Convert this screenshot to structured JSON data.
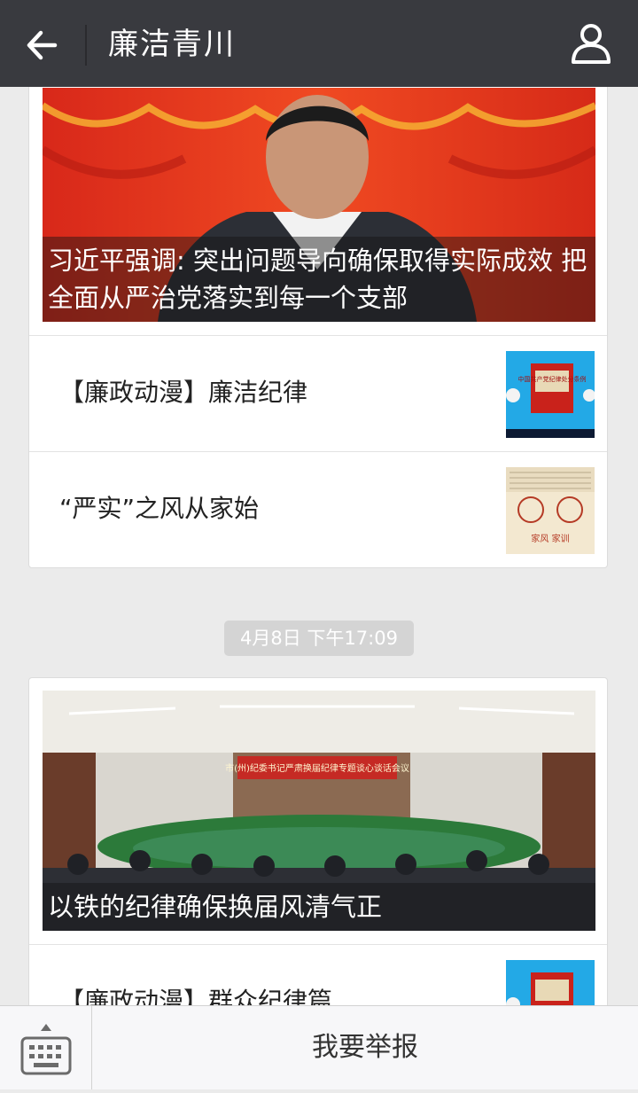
{
  "header": {
    "title": "廉洁青川",
    "back_icon": "arrow-left-icon",
    "profile_icon": "person-icon"
  },
  "feed": {
    "group1": {
      "cover_caption": "习近平强调: 突出问题导向确保取得实际成效 把全面从严治党落实到每一个支部",
      "items": [
        {
          "title": "【廉政动漫】廉洁纪律",
          "thumb_text": "中国共产党纪律处分条例"
        },
        {
          "title": "“严实”之风从家始",
          "thumb_text": "家风 家训"
        }
      ]
    },
    "timestamp": "4月8日 下午17:09",
    "group2": {
      "cover_caption": "以铁的纪律确保换届风清气正",
      "banner_text": "市(州)纪委书记严肃换届纪律专题谈心谈话会议",
      "items": [
        {
          "title": "【廉政动漫】群众纪律篇"
        }
      ]
    }
  },
  "bottombar": {
    "keyboard_icon": "keyboard-icon",
    "report_label": "我要举报"
  },
  "colors": {
    "header_bg": "#393a3f",
    "page_bg": "#ebebeb",
    "timestamp_bg": "#d4d4d4"
  }
}
